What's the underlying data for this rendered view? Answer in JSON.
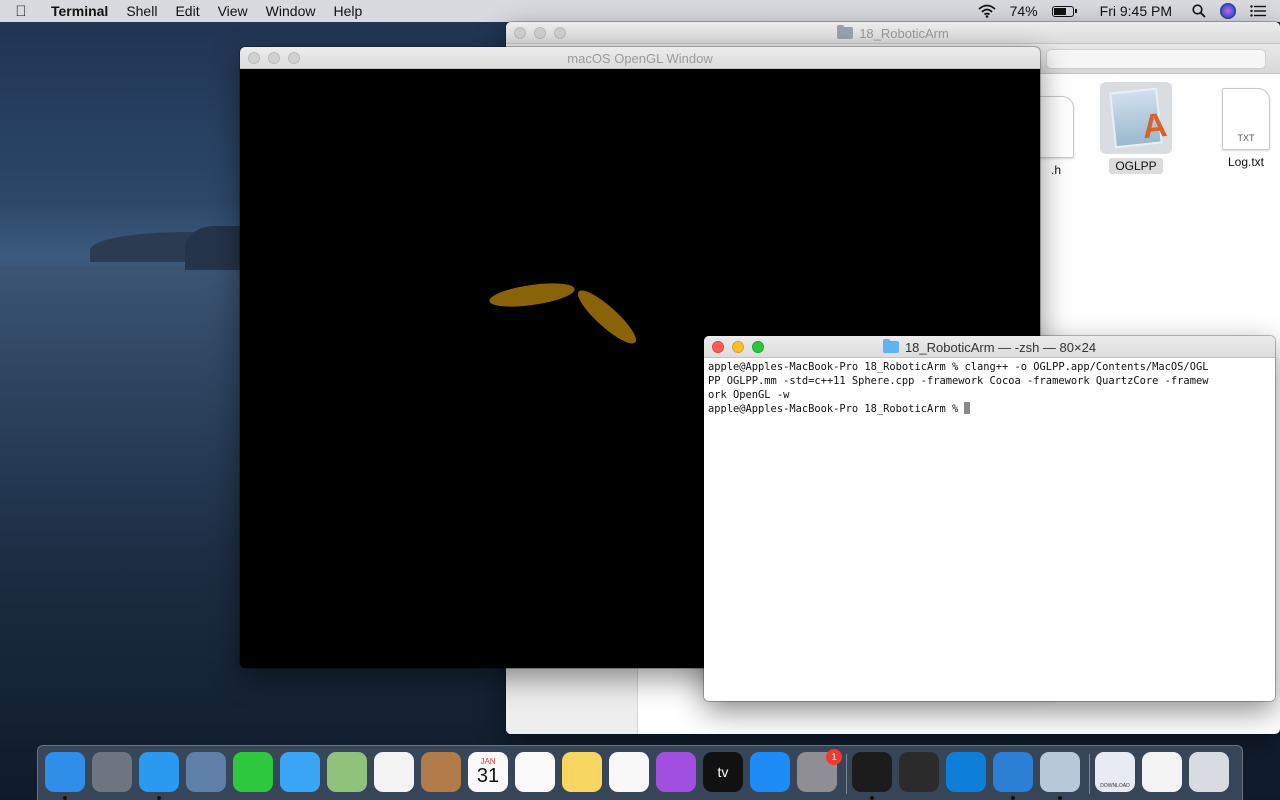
{
  "menubar": {
    "app_name": "Terminal",
    "menus": [
      "Shell",
      "Edit",
      "View",
      "Window",
      "Help"
    ],
    "battery_percent": "74%",
    "battery_level": 0.74,
    "clock": "Fri 9:45 PM"
  },
  "finder": {
    "title": "18_RoboticArm",
    "files": [
      {
        "label": ".h",
        "kind": "header"
      },
      {
        "label": "OGLPP",
        "kind": "app",
        "icon_text": ""
      },
      {
        "label": "Log.txt",
        "kind": "text",
        "icon_text": "TXT"
      }
    ]
  },
  "opengl_window": {
    "title": "macOS OpenGL Window",
    "shape_color": "#8a6208"
  },
  "terminal": {
    "title": "18_RoboticArm — -zsh — 80×24",
    "lines": [
      "apple@Apples-MacBook-Pro 18_RoboticArm % clang++ -o OGLPP.app/Contents/MacOS/OGL",
      "PP OGLPP.mm -std=c++11 Sphere.cpp -framework Cocoa -framework QuartzCore -framew",
      "ork OpenGL -w",
      "apple@Apples-MacBook-Pro 18_RoboticArm % "
    ]
  },
  "dock": {
    "apps": [
      {
        "name": "finder-icon",
        "color": "#2f8fe8",
        "running": true
      },
      {
        "name": "launchpad-icon",
        "color": "#6d7580",
        "running": false
      },
      {
        "name": "safari-icon",
        "color": "#2a9af0",
        "running": true
      },
      {
        "name": "mail-icon",
        "color": "#5d7fa8",
        "running": false
      },
      {
        "name": "facetime-icon",
        "color": "#2ec83f",
        "running": false
      },
      {
        "name": "messages-icon",
        "color": "#3aa4f5",
        "running": false
      },
      {
        "name": "maps-icon",
        "color": "#8fc27a",
        "running": false
      },
      {
        "name": "photos-icon",
        "color": "#f3f3f3",
        "running": false
      },
      {
        "name": "contacts-icon",
        "color": "#b07b48",
        "running": false
      },
      {
        "name": "calendar-icon",
        "color": "#fafafa",
        "running": false
      },
      {
        "name": "reminders-icon",
        "color": "#fafafa",
        "running": false
      },
      {
        "name": "notes-icon",
        "color": "#f6d561",
        "running": false
      },
      {
        "name": "music-icon",
        "color": "#f8f8f8",
        "running": false
      },
      {
        "name": "podcasts-icon",
        "color": "#a14fe0",
        "running": false
      },
      {
        "name": "tv-icon",
        "color": "#111111",
        "running": false
      },
      {
        "name": "app-store-icon",
        "color": "#1d8cf6",
        "running": false
      },
      {
        "name": "system-preferences-icon",
        "color": "#8e8e93",
        "running": false,
        "badge": "1"
      },
      {
        "name": "terminal-icon",
        "color": "#1c1c1c",
        "running": true
      },
      {
        "name": "midi-keyboard-icon",
        "color": "#2b2b2b",
        "running": false
      },
      {
        "name": "teamviewer-icon",
        "color": "#0e7fd8",
        "running": false
      },
      {
        "name": "xcode-icon",
        "color": "#2b7fd5",
        "running": true
      },
      {
        "name": "oglpp-app-icon",
        "color": "#b8c8d8",
        "running": true
      },
      {
        "name": "downloads-stack-icon",
        "color": "#e8ecf2",
        "running": false
      },
      {
        "name": "documents-stack-icon",
        "color": "#f3f3f3",
        "running": false
      },
      {
        "name": "trash-icon",
        "color": "#d8dbe0",
        "running": false
      }
    ],
    "calendar_month": "JAN",
    "calendar_day": "31",
    "tv_label": "tv",
    "downloads_label": "DOWNLOAD"
  }
}
